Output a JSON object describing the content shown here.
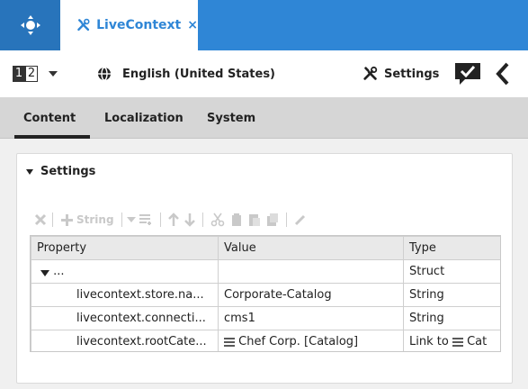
{
  "topbar": {
    "tab": {
      "label": "LiveContext",
      "close": "×"
    }
  },
  "toolbar": {
    "variant": {
      "first": "1",
      "second": "2"
    },
    "locale": "English (United States)",
    "settings_label": "Settings"
  },
  "subtabs": [
    {
      "label": "Content",
      "active": true
    },
    {
      "label": "Localization",
      "active": false
    },
    {
      "label": "System",
      "active": false
    }
  ],
  "panel": {
    "title": "Settings",
    "actions": {
      "string_label": "String"
    },
    "columns": [
      "Property",
      "Value",
      "Type"
    ],
    "rows": [
      {
        "property": "...",
        "value": "",
        "type": "Struct"
      },
      {
        "property": "livecontext.store.na...",
        "value": "Corporate-Catalog",
        "type": "String"
      },
      {
        "property": "livecontext.connecti...",
        "value": "cms1",
        "type": "String"
      },
      {
        "property": "livecontext.rootCate...",
        "value": "Chef Corp. [Catalog]",
        "type": "Link to",
        "type_suffix": "Cat"
      }
    ]
  },
  "colors": {
    "brand": "#2f86d6",
    "nav": "#2874bb",
    "subtab_bg": "#d6d6d6"
  }
}
